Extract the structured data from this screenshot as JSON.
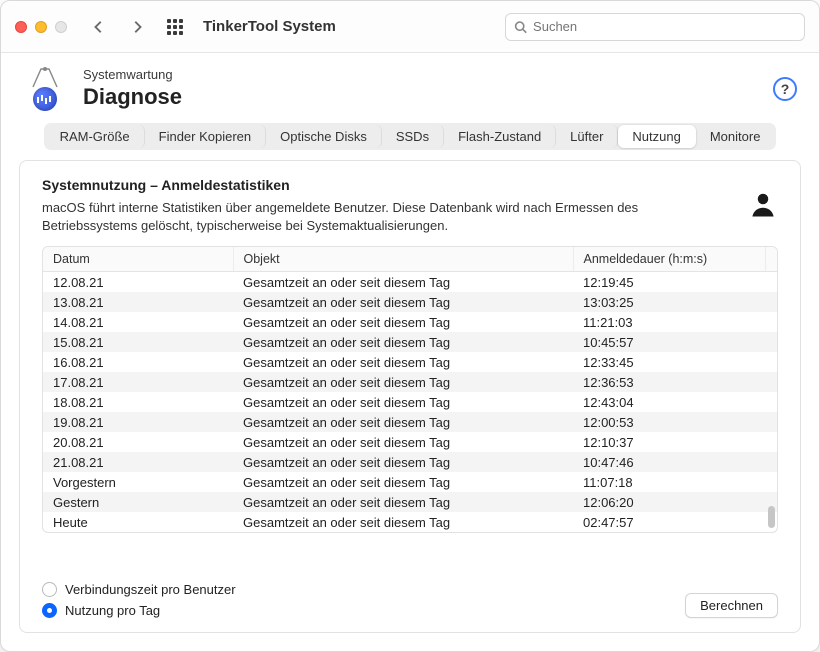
{
  "window": {
    "title": "TinkerTool System"
  },
  "search": {
    "placeholder": "Suchen"
  },
  "breadcrumb": "Systemwartung",
  "page_title": "Diagnose",
  "help_label": "?",
  "tabs": [
    {
      "label": "RAM-Größe"
    },
    {
      "label": "Finder Kopieren"
    },
    {
      "label": "Optische Disks"
    },
    {
      "label": "SSDs"
    },
    {
      "label": "Flash-Zustand"
    },
    {
      "label": "Lüfter"
    },
    {
      "label": "Nutzung",
      "active": true
    },
    {
      "label": "Monitore"
    }
  ],
  "section": {
    "title": "Systemnutzung – Anmeldestatistiken",
    "desc": "macOS führt interne Statistiken über angemeldete Benutzer. Diese Datenbank wird nach Ermessen des Betriebssystems gelöscht, typischerweise bei Systemaktualisierungen."
  },
  "columns": {
    "date": "Datum",
    "object": "Objekt",
    "duration": "Anmeldedauer (h:m:s)"
  },
  "rows": [
    {
      "date": "12.08.21",
      "object": "Gesamtzeit an oder seit diesem Tag",
      "duration": "12:19:45"
    },
    {
      "date": "13.08.21",
      "object": "Gesamtzeit an oder seit diesem Tag",
      "duration": "13:03:25"
    },
    {
      "date": "14.08.21",
      "object": "Gesamtzeit an oder seit diesem Tag",
      "duration": "11:21:03"
    },
    {
      "date": "15.08.21",
      "object": "Gesamtzeit an oder seit diesem Tag",
      "duration": "10:45:57"
    },
    {
      "date": "16.08.21",
      "object": "Gesamtzeit an oder seit diesem Tag",
      "duration": "12:33:45"
    },
    {
      "date": "17.08.21",
      "object": "Gesamtzeit an oder seit diesem Tag",
      "duration": "12:36:53"
    },
    {
      "date": "18.08.21",
      "object": "Gesamtzeit an oder seit diesem Tag",
      "duration": "12:43:04"
    },
    {
      "date": "19.08.21",
      "object": "Gesamtzeit an oder seit diesem Tag",
      "duration": "12:00:53"
    },
    {
      "date": "20.08.21",
      "object": "Gesamtzeit an oder seit diesem Tag",
      "duration": "12:10:37"
    },
    {
      "date": "21.08.21",
      "object": "Gesamtzeit an oder seit diesem Tag",
      "duration": "10:47:46"
    },
    {
      "date": "Vorgestern",
      "object": "Gesamtzeit an oder seit diesem Tag",
      "duration": "11:07:18"
    },
    {
      "date": "Gestern",
      "object": "Gesamtzeit an oder seit diesem Tag",
      "duration": "12:06:20"
    },
    {
      "date": "Heute",
      "object": "Gesamtzeit an oder seit diesem Tag",
      "duration": "02:47:57"
    }
  ],
  "radios": {
    "per_user": "Verbindungszeit pro Benutzer",
    "per_day": "Nutzung pro Tag",
    "selected": "per_day"
  },
  "compute_label": "Berechnen"
}
